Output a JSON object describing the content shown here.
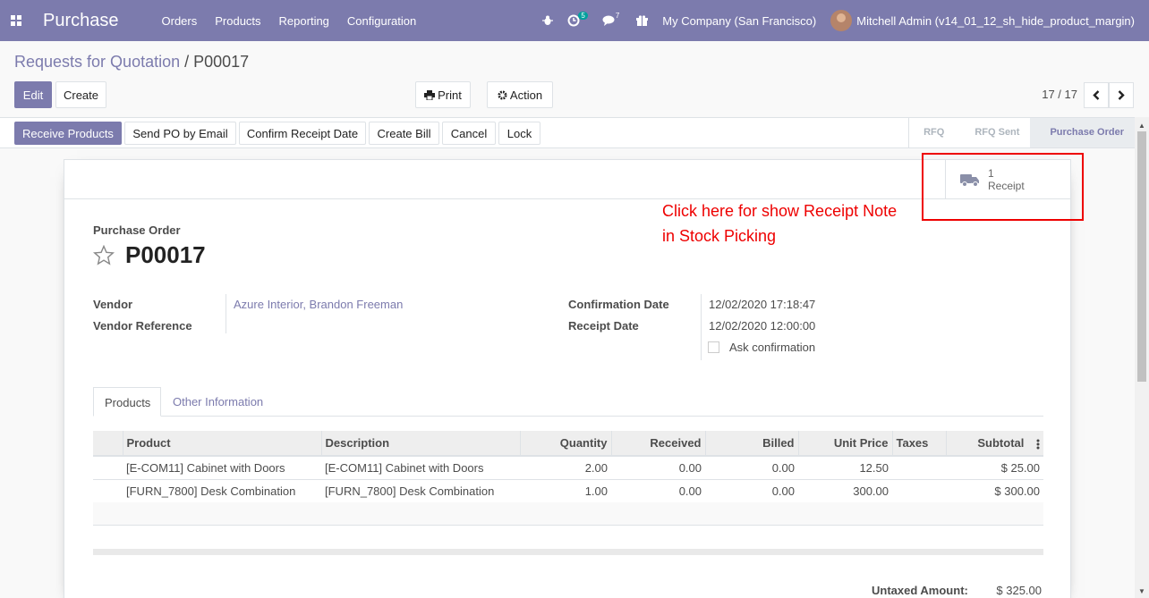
{
  "navbar": {
    "app_name": "Purchase",
    "menus": [
      "Orders",
      "Products",
      "Reporting",
      "Configuration"
    ],
    "activity_count": "5",
    "message_count": "7",
    "company": "My Company (San Francisco)",
    "user": "Mitchell Admin (v14_01_12_sh_hide_product_margin)"
  },
  "breadcrumb": {
    "parent": "Requests for Quotation",
    "separator": " / ",
    "current": "P00017"
  },
  "control": {
    "edit": "Edit",
    "create": "Create",
    "print": "Print",
    "action": "Action",
    "pager": "17 / 17"
  },
  "statusbar": {
    "buttons": [
      "Receive Products",
      "Send PO by Email",
      "Confirm Receipt Date",
      "Create Bill",
      "Cancel",
      "Lock"
    ],
    "stages": [
      "RFQ",
      "RFQ Sent",
      "Purchase Order"
    ],
    "active_stage": "Purchase Order"
  },
  "smart_button": {
    "count": "1",
    "label": "Receipt",
    "icon": "truck-icon"
  },
  "annotation": {
    "line1": "Click here for show Receipt Note",
    "line2": "in Stock Picking",
    "color": "#ee0000"
  },
  "document": {
    "type_label": "Purchase Order",
    "name": "P00017"
  },
  "fields": {
    "vendor_label": "Vendor",
    "vendor_value": "Azure Interior, Brandon Freeman",
    "vendor_ref_label": "Vendor Reference",
    "confirmation_date_label": "Confirmation Date",
    "confirmation_date_value": "12/02/2020 17:18:47",
    "receipt_date_label": "Receipt Date",
    "receipt_date_value": "12/02/2020 12:00:00",
    "ask_confirmation_label": "Ask confirmation"
  },
  "tabs": [
    "Products",
    "Other Information"
  ],
  "table": {
    "headers": [
      "Product",
      "Description",
      "Quantity",
      "Received",
      "Billed",
      "Unit Price",
      "Taxes",
      "Subtotal"
    ],
    "rows": [
      [
        "[E-COM11] Cabinet with Doors",
        "[E-COM11] Cabinet with Doors",
        "2.00",
        "0.00",
        "0.00",
        "12.50",
        "",
        "$ 25.00"
      ],
      [
        "[FURN_7800] Desk Combination",
        "[FURN_7800] Desk Combination",
        "1.00",
        "0.00",
        "0.00",
        "300.00",
        "",
        "$ 300.00"
      ]
    ]
  },
  "totals": {
    "untaxed_label": "Untaxed Amount:",
    "untaxed_value": "$ 325.00"
  },
  "colors": {
    "brand": "#7c7bad",
    "annotation": "#ee0000"
  }
}
